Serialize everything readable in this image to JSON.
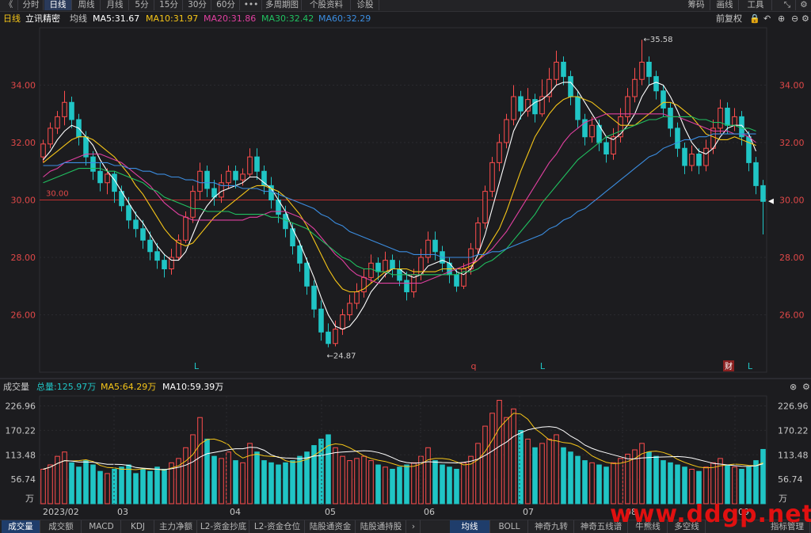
{
  "toolbar": {
    "items": [
      {
        "label": "《"
      },
      {
        "label": "分时"
      },
      {
        "label": "日线"
      },
      {
        "label": "周线"
      },
      {
        "label": "月线"
      },
      {
        "label": "5分"
      },
      {
        "label": "15分"
      },
      {
        "label": "30分"
      },
      {
        "label": "60分"
      },
      {
        "label": "•••"
      },
      {
        "label": "多周期图"
      },
      {
        "label": "个股资料"
      },
      {
        "label": "诊股"
      }
    ],
    "right_items": [
      {
        "label": "筹码"
      },
      {
        "label": "画线"
      },
      {
        "label": "工具"
      }
    ]
  },
  "chart_header": {
    "period": "日线",
    "stock_name": "立讯精密",
    "ma_label": "均线",
    "ma5": "MA5:31.67",
    "ma10": "MA10:31.97",
    "ma20": "MA20:31.86",
    "ma30": "MA30:32.42",
    "ma60": "MA60:32.29",
    "adjust": "前复权"
  },
  "price_axis": {
    "ticks": [
      "34.00",
      "32.00",
      "30.00",
      "28.00",
      "26.00"
    ]
  },
  "annotations": {
    "high": "35.58",
    "low": "24.87",
    "ref_line": "30.00",
    "markers": [
      "L",
      "q",
      "L",
      "财",
      "L"
    ]
  },
  "volume_header": {
    "label": "成交量",
    "total": "总量:125.97万",
    "ma5": "MA5:64.29万",
    "ma10": "MA10:59.39万"
  },
  "volume_axis": {
    "ticks": [
      "226.96",
      "170.22",
      "113.48",
      "56.74"
    ],
    "unit": "万"
  },
  "x_axis": {
    "labels": [
      "2023/02",
      "03",
      "04",
      "05",
      "06",
      "07",
      "08",
      "09"
    ]
  },
  "bottom_tabs": {
    "left": [
      {
        "label": "成交量"
      },
      {
        "label": "成交额"
      },
      {
        "label": "MACD"
      },
      {
        "label": "KDJ"
      },
      {
        "label": "主力净额"
      },
      {
        "label": "L2-资金抄底"
      },
      {
        "label": "L2-资金仓位"
      },
      {
        "label": "陆股通资金"
      },
      {
        "label": "陆股通持股"
      }
    ],
    "right": [
      {
        "label": "均线"
      },
      {
        "label": "BOLL"
      },
      {
        "label": "神奇九转"
      },
      {
        "label": "神奇五线谱"
      },
      {
        "label": "牛熊线"
      },
      {
        "label": "多空线"
      },
      {
        "label": "指标管理"
      }
    ]
  },
  "watermark": "www.ddgp.net",
  "colors": {
    "up": "#ff4d4d",
    "down": "#20c5c5",
    "ma5": "#ffffff",
    "ma10": "#f5c518",
    "ma20": "#e040a0",
    "ma30": "#20c060",
    "ma60": "#3b8de0"
  },
  "chart_data": {
    "type": "candlestick",
    "ylim": [
      24.0,
      36.0
    ],
    "vol_max": 250,
    "candles": [
      [
        31.5,
        31.95,
        32.1,
        31.3,
        80
      ],
      [
        31.95,
        32.5,
        32.7,
        31.8,
        90
      ],
      [
        32.5,
        32.9,
        33.1,
        32.3,
        110
      ],
      [
        32.9,
        33.4,
        33.8,
        32.6,
        120
      ],
      [
        33.4,
        32.8,
        33.6,
        32.5,
        95
      ],
      [
        32.8,
        32.2,
        33.0,
        31.9,
        85
      ],
      [
        32.2,
        31.5,
        32.4,
        31.2,
        100
      ],
      [
        31.5,
        31.0,
        31.7,
        30.7,
        90
      ],
      [
        31.0,
        30.6,
        31.3,
        30.3,
        75
      ],
      [
        30.6,
        30.9,
        31.1,
        30.2,
        70
      ],
      [
        30.9,
        30.3,
        31.0,
        29.9,
        80
      ],
      [
        30.3,
        29.8,
        30.5,
        29.6,
        85
      ],
      [
        29.8,
        29.3,
        30.1,
        29.0,
        90
      ],
      [
        29.3,
        29.0,
        29.6,
        28.7,
        70
      ],
      [
        29.0,
        28.6,
        29.3,
        28.3,
        80
      ],
      [
        28.6,
        28.2,
        28.9,
        27.9,
        75
      ],
      [
        28.2,
        27.9,
        28.5,
        27.6,
        85
      ],
      [
        27.9,
        27.6,
        28.1,
        27.3,
        80
      ],
      [
        27.6,
        28.0,
        28.3,
        27.4,
        95
      ],
      [
        28.0,
        28.6,
        28.8,
        27.9,
        105
      ],
      [
        28.6,
        29.4,
        29.6,
        28.5,
        130
      ],
      [
        29.4,
        30.3,
        30.5,
        29.2,
        160
      ],
      [
        30.3,
        31.0,
        31.3,
        30.0,
        200
      ],
      [
        31.0,
        30.4,
        31.2,
        30.1,
        150
      ],
      [
        30.4,
        30.1,
        30.7,
        29.8,
        110
      ],
      [
        30.1,
        30.6,
        30.9,
        29.9,
        105
      ],
      [
        30.6,
        31.0,
        31.2,
        30.4,
        120
      ],
      [
        31.0,
        30.7,
        31.2,
        30.4,
        100
      ],
      [
        30.7,
        30.9,
        31.1,
        30.5,
        95
      ],
      [
        30.9,
        31.5,
        31.8,
        30.8,
        140
      ],
      [
        31.5,
        31.0,
        31.8,
        30.7,
        120
      ],
      [
        31.0,
        30.5,
        31.2,
        30.2,
        100
      ],
      [
        30.5,
        30.0,
        30.8,
        29.7,
        95
      ],
      [
        30.0,
        29.5,
        30.3,
        29.2,
        90
      ],
      [
        29.5,
        29.0,
        29.8,
        28.7,
        95
      ],
      [
        29.0,
        28.4,
        29.2,
        28.1,
        100
      ],
      [
        28.4,
        27.8,
        28.6,
        27.5,
        110
      ],
      [
        27.8,
        27.0,
        28.0,
        26.7,
        120
      ],
      [
        27.0,
        26.2,
        27.2,
        25.9,
        135
      ],
      [
        26.2,
        25.4,
        26.5,
        25.1,
        150
      ],
      [
        25.4,
        25.0,
        25.7,
        24.87,
        160
      ],
      [
        25.0,
        25.5,
        25.8,
        24.9,
        130
      ],
      [
        25.5,
        26.0,
        26.2,
        25.3,
        110
      ],
      [
        26.0,
        26.4,
        26.7,
        25.8,
        100
      ],
      [
        26.4,
        26.8,
        27.1,
        26.2,
        105
      ],
      [
        26.8,
        27.3,
        27.6,
        26.6,
        110
      ],
      [
        27.3,
        27.8,
        28.1,
        27.1,
        100
      ],
      [
        27.8,
        27.5,
        28.0,
        27.2,
        90
      ],
      [
        27.5,
        27.9,
        28.2,
        27.3,
        85
      ],
      [
        27.9,
        27.6,
        28.1,
        27.3,
        80
      ],
      [
        27.6,
        27.2,
        27.9,
        27.0,
        85
      ],
      [
        27.2,
        26.8,
        27.5,
        26.5,
        90
      ],
      [
        26.8,
        27.4,
        27.6,
        26.6,
        95
      ],
      [
        27.4,
        28.0,
        28.3,
        27.2,
        110
      ],
      [
        28.0,
        28.6,
        28.9,
        27.8,
        130
      ],
      [
        28.6,
        28.2,
        28.9,
        27.9,
        100
      ],
      [
        28.2,
        27.8,
        28.4,
        27.5,
        90
      ],
      [
        27.8,
        27.4,
        28.0,
        27.1,
        85
      ],
      [
        27.4,
        27.0,
        27.6,
        26.8,
        80
      ],
      [
        27.0,
        27.6,
        27.8,
        26.9,
        95
      ],
      [
        27.6,
        28.3,
        28.5,
        27.4,
        110
      ],
      [
        28.3,
        29.2,
        29.4,
        28.1,
        140
      ],
      [
        29.2,
        30.3,
        30.5,
        29.0,
        180
      ],
      [
        30.3,
        31.3,
        31.5,
        30.1,
        210
      ],
      [
        31.3,
        32.0,
        32.3,
        31.0,
        240
      ],
      [
        32.0,
        32.8,
        33.0,
        31.8,
        200
      ],
      [
        32.8,
        33.6,
        34.0,
        32.6,
        220
      ],
      [
        33.6,
        33.1,
        33.8,
        32.8,
        170
      ],
      [
        33.1,
        33.5,
        33.9,
        32.9,
        150
      ],
      [
        33.5,
        33.0,
        33.7,
        32.7,
        130
      ],
      [
        33.0,
        33.6,
        34.2,
        32.9,
        140
      ],
      [
        33.6,
        34.2,
        34.6,
        33.4,
        150
      ],
      [
        34.2,
        34.8,
        35.2,
        34.0,
        160
      ],
      [
        34.8,
        34.3,
        35.0,
        34.0,
        130
      ],
      [
        34.3,
        33.6,
        34.5,
        33.3,
        120
      ],
      [
        33.6,
        32.8,
        33.8,
        32.5,
        110
      ],
      [
        32.8,
        32.2,
        33.0,
        31.9,
        100
      ],
      [
        32.2,
        32.6,
        32.9,
        32.0,
        95
      ],
      [
        32.6,
        32.0,
        32.8,
        31.7,
        90
      ],
      [
        32.0,
        31.6,
        32.2,
        31.3,
        85
      ],
      [
        31.6,
        32.2,
        32.5,
        31.4,
        95
      ],
      [
        32.2,
        32.9,
        33.2,
        32.0,
        105
      ],
      [
        32.9,
        33.6,
        33.9,
        32.7,
        115
      ],
      [
        33.6,
        34.2,
        34.6,
        33.4,
        125
      ],
      [
        34.2,
        34.8,
        35.58,
        34.0,
        140
      ],
      [
        34.8,
        34.3,
        35.0,
        34.0,
        120
      ],
      [
        34.3,
        33.8,
        34.5,
        33.5,
        110
      ],
      [
        33.8,
        33.2,
        34.0,
        32.9,
        100
      ],
      [
        33.2,
        32.5,
        33.4,
        32.2,
        95
      ],
      [
        32.5,
        31.8,
        32.7,
        31.5,
        90
      ],
      [
        31.8,
        31.2,
        32.0,
        30.9,
        85
      ],
      [
        31.2,
        31.6,
        31.9,
        31.0,
        80
      ],
      [
        31.6,
        31.2,
        31.8,
        30.9,
        75
      ],
      [
        31.2,
        31.8,
        32.1,
        31.0,
        85
      ],
      [
        31.8,
        32.5,
        32.8,
        31.6,
        95
      ],
      [
        32.5,
        33.2,
        33.5,
        32.3,
        105
      ],
      [
        33.2,
        32.6,
        33.4,
        32.3,
        90
      ],
      [
        32.6,
        32.9,
        33.2,
        32.4,
        85
      ],
      [
        32.9,
        32.2,
        33.1,
        31.9,
        80
      ],
      [
        32.2,
        31.3,
        32.4,
        31.0,
        85
      ],
      [
        31.3,
        30.5,
        31.5,
        30.2,
        100
      ],
      [
        30.5,
        29.95,
        30.7,
        28.8,
        126
      ]
    ],
    "ma": {
      "ma5": [
        31.4,
        31.7,
        32.1,
        32.4,
        32.6,
        32.5,
        32.2,
        31.9,
        31.4,
        31.0,
        30.7,
        30.3,
        29.9,
        29.5,
        29.2,
        28.8,
        28.4,
        28.1,
        27.9,
        27.9,
        28.2,
        28.8,
        29.4,
        29.8,
        30.1,
        30.3,
        30.4,
        30.5,
        30.6,
        30.8,
        30.8,
        30.6,
        30.4,
        30.0,
        29.6,
        29.0,
        28.5,
        27.9,
        27.3,
        26.6,
        26.0,
        25.6,
        25.5,
        25.6,
        25.9,
        26.3,
        26.8,
        27.1,
        27.4,
        27.6,
        27.6,
        27.4,
        27.3,
        27.4,
        27.7,
        27.8,
        27.9,
        27.8,
        27.5,
        27.4,
        27.6,
        28.1,
        28.8,
        29.7,
        30.6,
        31.5,
        32.4,
        32.9,
        33.2,
        33.4,
        33.5,
        33.7,
        34.0,
        34.1,
        34.1,
        33.8,
        33.4,
        33.0,
        32.6,
        32.2,
        32.1,
        32.3,
        32.6,
        33.0,
        33.6,
        34.0,
        34.1,
        34.0,
        33.6,
        33.1,
        32.5,
        32.0,
        31.7,
        31.6,
        31.8,
        32.2,
        32.5,
        32.6,
        32.6,
        32.3,
        31.7
      ],
      "ma10": [
        31.3,
        31.5,
        31.7,
        31.9,
        32.1,
        32.2,
        32.2,
        32.1,
        31.9,
        31.7,
        31.5,
        31.2,
        30.9,
        30.5,
        30.2,
        29.8,
        29.4,
        29.0,
        28.7,
        28.5,
        28.4,
        28.5,
        28.8,
        29.1,
        29.4,
        29.6,
        29.8,
        30.0,
        30.2,
        30.4,
        30.5,
        30.5,
        30.4,
        30.3,
        30.1,
        29.8,
        29.5,
        29.1,
        28.6,
        28.1,
        27.6,
        27.2,
        26.9,
        26.8,
        26.8,
        26.9,
        27.1,
        27.3,
        27.5,
        27.6,
        27.6,
        27.6,
        27.5,
        27.5,
        27.5,
        27.5,
        27.6,
        27.6,
        27.6,
        27.6,
        27.7,
        27.9,
        28.2,
        28.6,
        29.0,
        29.6,
        30.3,
        31.0,
        31.6,
        32.2,
        32.6,
        33.0,
        33.3,
        33.5,
        33.6,
        33.6,
        33.5,
        33.4,
        33.2,
        33.0,
        32.8,
        32.6,
        32.6,
        32.6,
        32.8,
        33.0,
        33.2,
        33.4,
        33.4,
        33.3,
        33.1,
        32.9,
        32.6,
        32.3,
        32.2,
        32.1,
        32.1,
        32.2,
        32.1,
        32.0,
        31.9
      ],
      "ma20": [
        30.8,
        31.0,
        31.1,
        31.3,
        31.4,
        31.5,
        31.6,
        31.6,
        31.6,
        31.5,
        31.4,
        31.3,
        31.1,
        30.9,
        30.7,
        30.5,
        30.2,
        29.9,
        29.7,
        29.5,
        29.4,
        29.3,
        29.3,
        29.3,
        29.3,
        29.3,
        29.3,
        29.3,
        29.3,
        29.4,
        29.4,
        29.5,
        29.6,
        29.6,
        29.6,
        29.5,
        29.4,
        29.2,
        29.0,
        28.7,
        28.4,
        28.1,
        27.9,
        27.6,
        27.4,
        27.3,
        27.2,
        27.1,
        27.1,
        27.1,
        27.1,
        27.1,
        27.1,
        27.1,
        27.2,
        27.3,
        27.4,
        27.5,
        27.6,
        27.7,
        27.8,
        27.9,
        28.1,
        28.3,
        28.6,
        28.9,
        29.3,
        29.7,
        30.1,
        30.5,
        30.9,
        31.3,
        31.6,
        32.0,
        32.3,
        32.5,
        32.7,
        32.8,
        32.9,
        33.0,
        33.0,
        33.0,
        33.0,
        33.0,
        33.0,
        33.0,
        33.0,
        33.0,
        32.9,
        32.9,
        32.8,
        32.7,
        32.6,
        32.5,
        32.4,
        32.4,
        32.4,
        32.3,
        32.3,
        32.2,
        32.0
      ],
      "ma30": [
        30.6,
        30.7,
        30.8,
        30.9,
        31.0,
        31.1,
        31.1,
        31.1,
        31.1,
        31.0,
        31.0,
        30.9,
        30.8,
        30.7,
        30.6,
        30.4,
        30.3,
        30.1,
        30.0,
        29.9,
        29.8,
        29.7,
        29.7,
        29.6,
        29.6,
        29.6,
        29.6,
        29.5,
        29.5,
        29.5,
        29.5,
        29.5,
        29.4,
        29.4,
        29.3,
        29.2,
        29.1,
        29.0,
        28.8,
        28.6,
        28.4,
        28.2,
        28.0,
        27.9,
        27.7,
        27.6,
        27.6,
        27.5,
        27.5,
        27.4,
        27.4,
        27.4,
        27.4,
        27.4,
        27.4,
        27.4,
        27.4,
        27.4,
        27.4,
        27.5,
        27.5,
        27.6,
        27.8,
        27.9,
        28.1,
        28.3,
        28.6,
        28.9,
        29.2,
        29.5,
        29.9,
        30.2,
        30.5,
        30.8,
        31.1,
        31.4,
        31.6,
        31.8,
        32.0,
        32.2,
        32.3,
        32.4,
        32.5,
        32.6,
        32.7,
        32.8,
        32.8,
        32.9,
        32.9,
        32.9,
        32.9,
        32.9,
        32.8,
        32.8,
        32.7,
        32.7,
        32.6,
        32.6,
        32.5,
        32.5,
        32.4
      ],
      "ma60": [
        31.2,
        31.2,
        31.2,
        31.3,
        31.3,
        31.3,
        31.3,
        31.3,
        31.3,
        31.3,
        31.2,
        31.2,
        31.1,
        31.1,
        31.0,
        31.0,
        30.9,
        30.9,
        30.8,
        30.8,
        30.7,
        30.7,
        30.6,
        30.6,
        30.6,
        30.5,
        30.5,
        30.5,
        30.4,
        30.4,
        30.4,
        30.3,
        30.3,
        30.2,
        30.1,
        30.0,
        29.9,
        29.8,
        29.7,
        29.5,
        29.4,
        29.2,
        29.1,
        28.9,
        28.8,
        28.7,
        28.6,
        28.5,
        28.4,
        28.3,
        28.2,
        28.2,
        28.1,
        28.1,
        28.1,
        28.1,
        28.0,
        28.0,
        28.0,
        28.0,
        28.0,
        28.1,
        28.1,
        28.2,
        28.2,
        28.3,
        28.4,
        28.5,
        28.6,
        28.7,
        28.8,
        29.0,
        29.1,
        29.3,
        29.4,
        29.6,
        29.7,
        29.9,
        30.1,
        30.3,
        30.5,
        30.7,
        30.9,
        31.1,
        31.3,
        31.5,
        31.6,
        31.8,
        31.9,
        32.0,
        32.1,
        32.1,
        32.2,
        32.2,
        32.3,
        32.3,
        32.3,
        32.3,
        32.3,
        32.3,
        32.3
      ]
    }
  }
}
